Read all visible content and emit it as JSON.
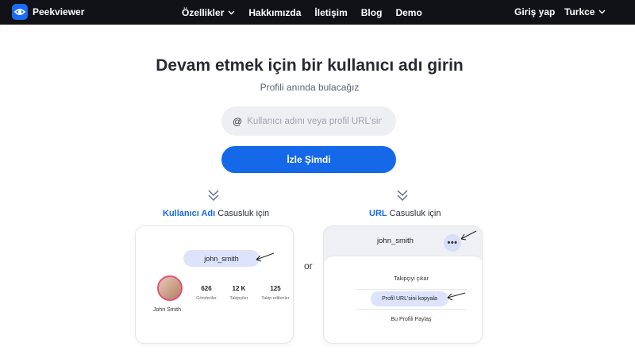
{
  "brand": {
    "name": "Peekviewer"
  },
  "nav": {
    "links": [
      "Özellikler",
      "Hakkımızda",
      "İletişim",
      "Blog",
      "Demo"
    ],
    "login": "Giriş yap",
    "language": "Turkce"
  },
  "hero": {
    "title": "Devam etmek için bir kullanıcı adı girin",
    "subtitle": "Profili anında bulacağız",
    "search_placeholder": "Kullanıcı adını veya profil URL'sini girin",
    "at_symbol": "@",
    "cta": "İzle Şimdi"
  },
  "sections": {
    "username": {
      "accent": "Kullanıcı Adı",
      "rest": " Casusluk için"
    },
    "url": {
      "accent": "URL",
      "rest": " Casusluk için"
    },
    "or": "or"
  },
  "card_left": {
    "username": "john_smith",
    "avatar_name": "John Smith",
    "stats": [
      {
        "value": "626",
        "label": "Gönderiler"
      },
      {
        "value": "12 K",
        "label": "Takipçiler"
      },
      {
        "value": "125",
        "label": "Takip edilenler"
      }
    ]
  },
  "card_right": {
    "username": "john_smith",
    "dots": "•••",
    "menu": [
      "Takipçiyi çıkar",
      "Profil URL'sini kopyala",
      "Bu Profili Paylaş"
    ]
  },
  "colors": {
    "accent": "#1569e8",
    "nav_bg": "#111217",
    "pill": "#dce3fb"
  }
}
